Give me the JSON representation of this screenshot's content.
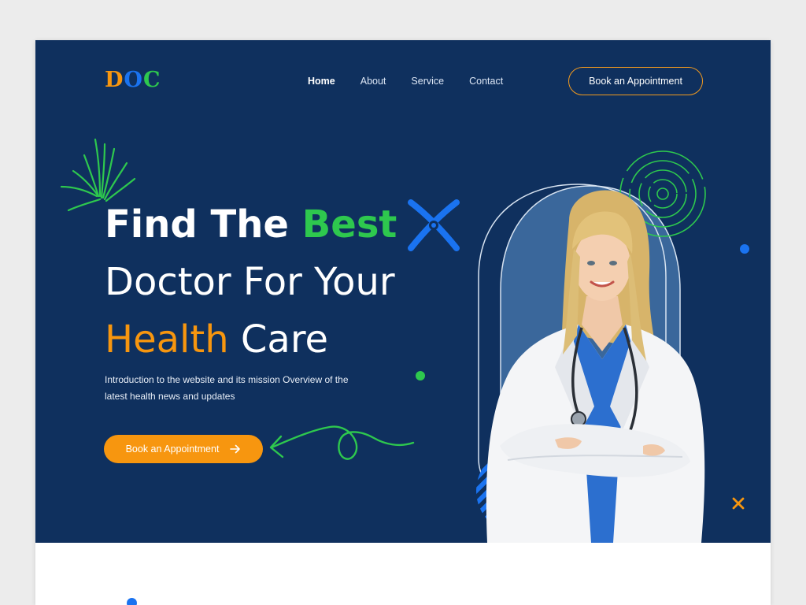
{
  "header": {
    "logo": {
      "letters": [
        "D",
        "O",
        "C"
      ],
      "colors": [
        "#f7960f",
        "#1a73f0",
        "#2ec84e"
      ]
    },
    "nav": [
      {
        "label": "Home",
        "active": true
      },
      {
        "label": "About",
        "active": false
      },
      {
        "label": "Service",
        "active": false
      },
      {
        "label": "Contact",
        "active": false
      }
    ],
    "appointment_button": "Book an Appointment"
  },
  "hero": {
    "line1_a": "Find The ",
    "line1_b": "Best",
    "line2": "Doctor For Your",
    "line3_a": "Health",
    "line3_b": " Care",
    "intro": "Introduction to the website and its mission Overview of the latest health news and updates",
    "cta_label": "Book an Appointment",
    "cta_icon": "arrow-right-icon"
  },
  "colors": {
    "background": "#0f305e",
    "green": "#2ec84e",
    "orange": "#f7960f",
    "blue": "#1a73f0",
    "white": "#ffffff"
  }
}
